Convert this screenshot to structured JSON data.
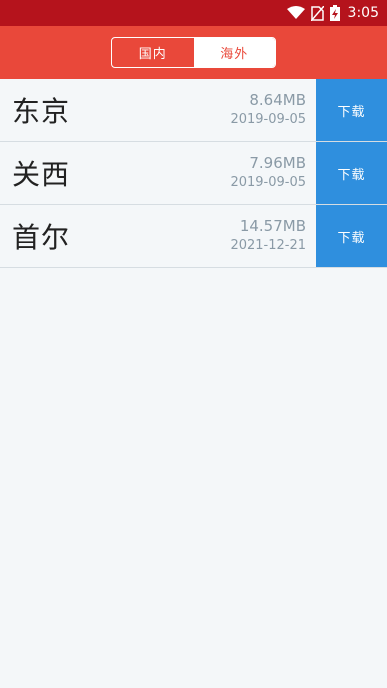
{
  "status_bar": {
    "time": "3:05",
    "icons": [
      "wifi-icon",
      "no-sim-icon",
      "battery-charging-icon"
    ]
  },
  "header": {
    "tabs": [
      {
        "label": "国内",
        "active": false
      },
      {
        "label": "海外",
        "active": true
      }
    ]
  },
  "colors": {
    "status_bar": "#b5131c",
    "header": "#e9483a",
    "download_button": "#2f8fde",
    "background": "#f4f7f9"
  },
  "cities": [
    {
      "name": "东京",
      "size": "8.64MB",
      "date": "2019-09-05",
      "button": "下载"
    },
    {
      "name": "关西",
      "size": "7.96MB",
      "date": "2019-09-05",
      "button": "下载"
    },
    {
      "name": "首尔",
      "size": "14.57MB",
      "date": "2021-12-21",
      "button": "下载"
    }
  ]
}
